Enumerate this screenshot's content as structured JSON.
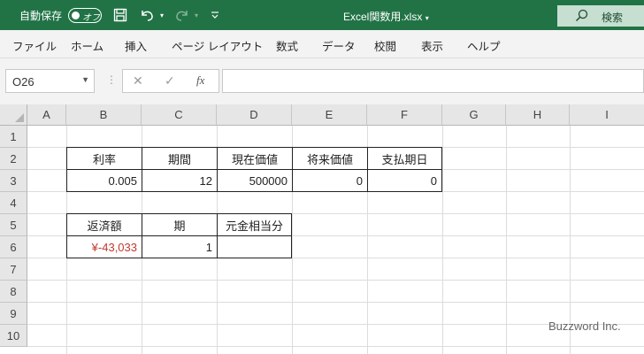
{
  "titlebar": {
    "autosave_label": "自動保存",
    "autosave_toggle": "オフ",
    "file_title": "Excel関数用.xlsx",
    "search_label": "検索",
    "icons": [
      "save-icon",
      "undo-icon",
      "redo-icon",
      "customize-icon"
    ]
  },
  "menu": {
    "items": [
      {
        "label": "ファイル"
      },
      {
        "label": "ホーム"
      },
      {
        "label": "挿入"
      },
      {
        "label": "ページ レイアウト"
      },
      {
        "label": "数式"
      },
      {
        "label": "データ"
      },
      {
        "label": "校閲"
      },
      {
        "label": "表示"
      },
      {
        "label": "ヘルプ"
      }
    ]
  },
  "formula_bar": {
    "name_box": "O26",
    "cancel": "✕",
    "enter": "✓",
    "fx": "fx",
    "content": ""
  },
  "sheet": {
    "columns": [
      "A",
      "B",
      "C",
      "D",
      "E",
      "F",
      "G",
      "H",
      "I"
    ],
    "rows": [
      "1",
      "2",
      "3",
      "4",
      "5",
      "6",
      "7",
      "8",
      "9",
      "10"
    ],
    "table1": {
      "headers": [
        "利率",
        "期間",
        "現在価値",
        "将来価値",
        "支払期日"
      ],
      "values": [
        "0.005",
        "12",
        "500000",
        "0",
        "0"
      ]
    },
    "table2": {
      "headers": [
        "返済額",
        "期",
        "元金相当分"
      ],
      "values": [
        "¥-43,033",
        "1",
        ""
      ]
    }
  },
  "watermark": "Buzzword Inc.",
  "colors": {
    "excel_green": "#217346",
    "negative_red": "#c0392b"
  }
}
